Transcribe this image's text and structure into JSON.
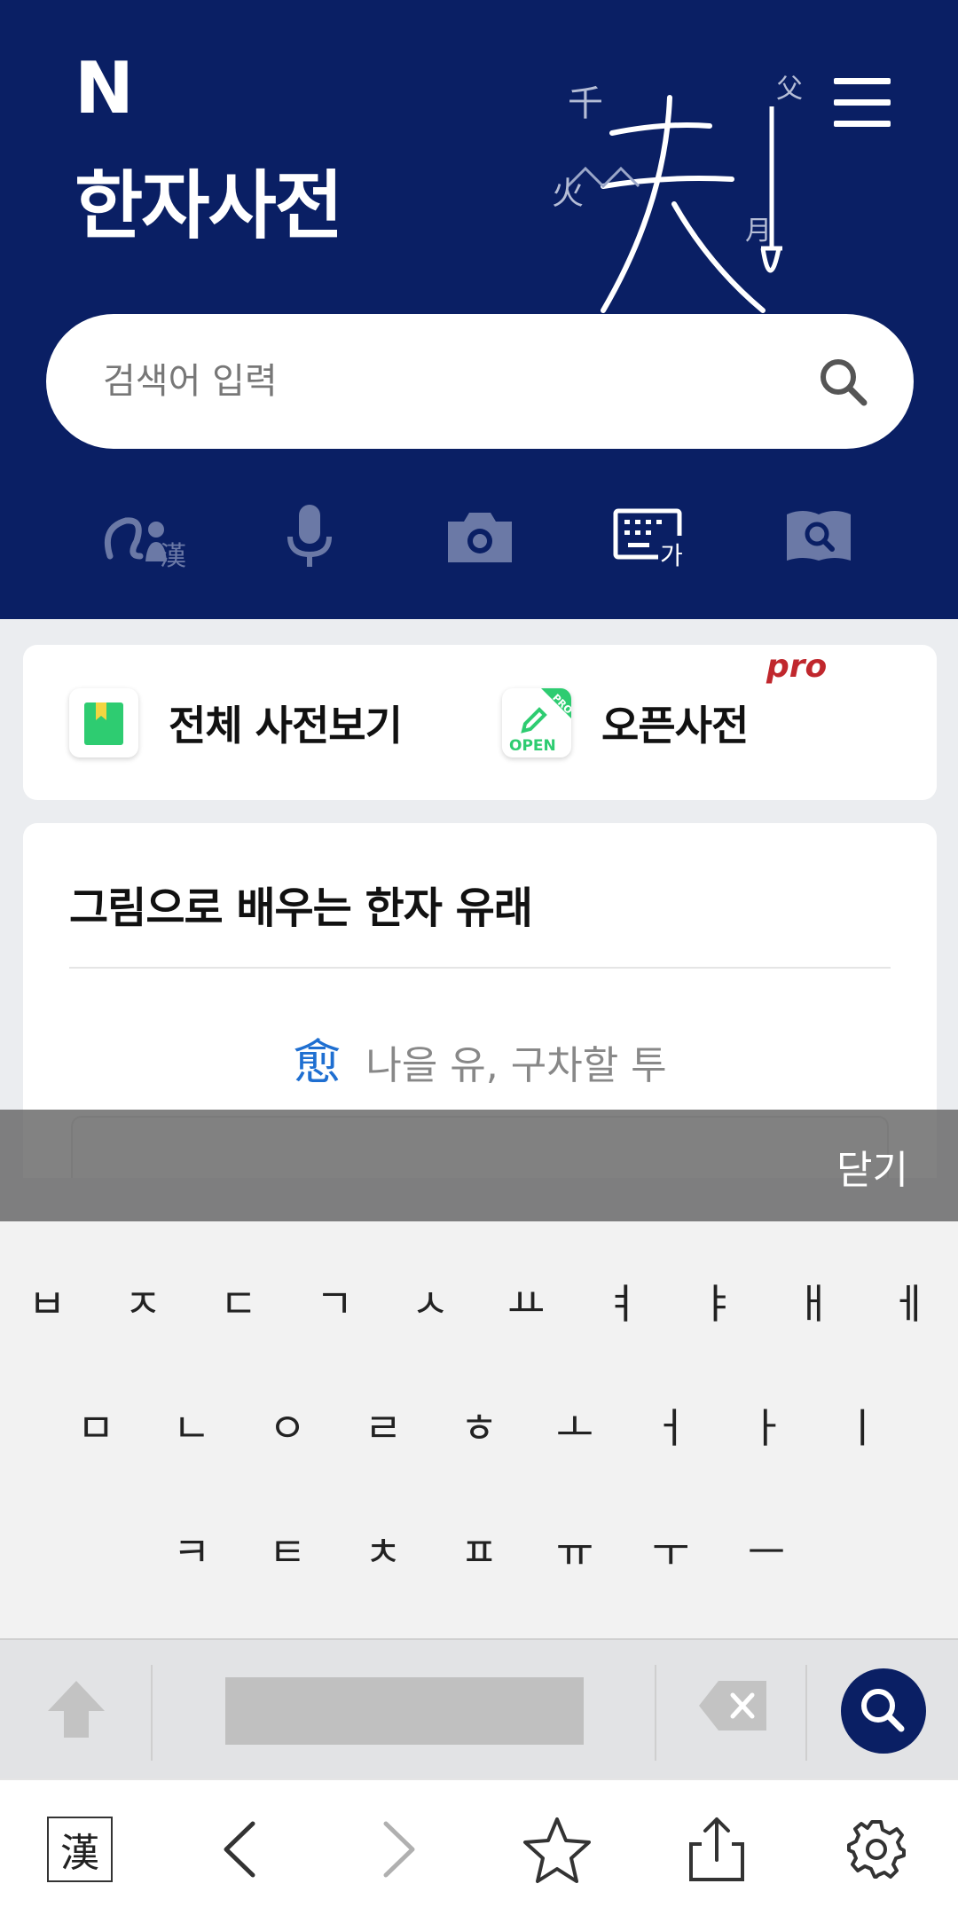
{
  "header": {
    "logo": "N",
    "title": "한자사전",
    "art_glyphs": {
      "main": "天",
      "small1": "千",
      "small2": "火",
      "small3": "月",
      "small4": "父"
    }
  },
  "search": {
    "placeholder": "검색어 입력"
  },
  "input_tools": [
    {
      "name": "handwriting-icon",
      "label": "漢",
      "active": false
    },
    {
      "name": "microphone-icon",
      "active": false
    },
    {
      "name": "camera-icon",
      "active": false
    },
    {
      "name": "korean-keyboard-icon",
      "label": "가",
      "active": true
    },
    {
      "name": "radical-search-icon",
      "active": false
    }
  ],
  "quick_links": {
    "all_dictionaries": "전체 사전보기",
    "open_dictionary": "오픈사전",
    "pro_badge": "pro",
    "open_icon_text": "OPEN",
    "pro_icon_text": "PRO"
  },
  "origin_card": {
    "title": "그림으로 배우는 한자 유래",
    "hanja": "愈",
    "meaning": "나을 유, 구차할 투"
  },
  "overlay": {
    "close_label": "닫기"
  },
  "keyboard": {
    "row1": [
      "ㅂ",
      "ㅈ",
      "ㄷ",
      "ㄱ",
      "ㅅ",
      "ㅛ",
      "ㅕ",
      "ㅑ",
      "ㅐ",
      "ㅔ"
    ],
    "row2": [
      "ㅁ",
      "ㄴ",
      "ㅇ",
      "ㄹ",
      "ㅎ",
      "ㅗ",
      "ㅓ",
      "ㅏ",
      "ㅣ"
    ],
    "row3": [
      "ㅋ",
      "ㅌ",
      "ㅊ",
      "ㅍ",
      "ㅠ",
      "ㅜ",
      "ㅡ"
    ]
  },
  "bottom_bar": {
    "hanja_label": "漢"
  },
  "colors": {
    "brand_navy": "#0a1f64",
    "link_blue": "#1f6fd1",
    "pro_red": "#c0272d",
    "green": "#2ecc71"
  }
}
